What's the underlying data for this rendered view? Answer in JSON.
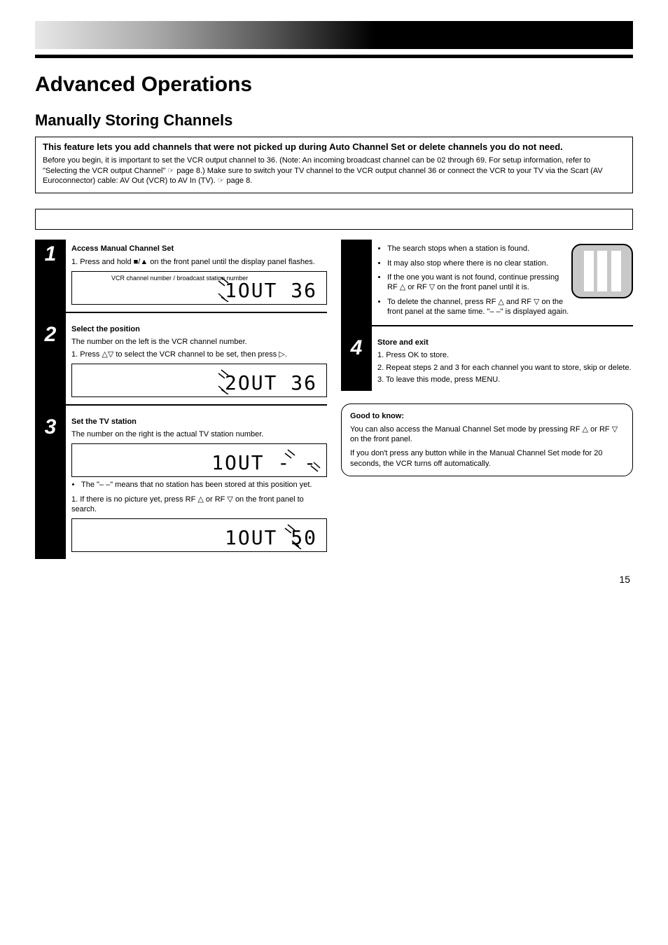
{
  "header": {},
  "title": "Advanced Operations",
  "section1": {
    "heading": "Manually Storing Channels",
    "infobox_heading": "This feature lets you add channels that were not picked up during Auto Channel Set or delete channels you do not need.",
    "infobox_para": "Before you begin, it is important to set the VCR output channel to 36. (Note: An incoming broadcast channel can be 02 through 69. For setup information, refer to \"Selecting the VCR output Channel\" ☞ page 8.) Make sure to switch your TV channel to the VCR output channel 36 or connect the VCR to your TV via the Scart (AV Euroconnector) cable: AV Out (VCR) to AV In (TV). ☞ page 8.",
    "note": ""
  },
  "steps": {
    "s1": {
      "heading": "Access Manual Channel Set",
      "p1": "1. Press and hold ■/▲ on the front panel until the display panel flashes.",
      "lcd_channel_label": "VCR channel number / broadcast station number",
      "lcd1": "1OUT 36"
    },
    "s2": {
      "heading": "Select the position",
      "p1": "The number on the left is the VCR channel number.",
      "p2": "1. Press △▽ to select the VCR channel to be set, then press ▷.",
      "lcd2": "2OUT 36"
    },
    "s3": {
      "heading": "Set the TV station",
      "p1": "The number on the right is the actual TV station number.",
      "lcd3": "1OUT - -",
      "bullet": "The \"– –\" means that no station has been stored at this position yet.",
      "p2": "1. If there is no picture yet, press RF △ or RF ▽ on the front panel to search.",
      "lcd4": "1OUT 50"
    },
    "s4": {
      "bullets": [
        "The search stops when a station is found.",
        "It may also stop where there is no clear station.",
        "If the one you want is not found, continue pressing RF △ or RF ▽ on the front panel until it is.",
        "To delete the channel, press RF △ and RF ▽ on the front panel at the same time. \"– –\" is displayed again."
      ]
    },
    "s5": {
      "heading": "Store and exit",
      "p1": "1. Press OK to store.",
      "p2": "2. Repeat steps 2 and 3 for each channel you want to store, skip or delete.",
      "p3": "3. To leave this mode, press MENU."
    }
  },
  "goodbox": {
    "heading": "Good to know:",
    "line1": "You can also access the Manual Channel Set mode by pressing RF △ or RF ▽ on the front panel.",
    "line2": "If you don't press any button while in the Manual Channel Set mode for 20 seconds, the VCR turns off automatically."
  },
  "pagenum": "15"
}
